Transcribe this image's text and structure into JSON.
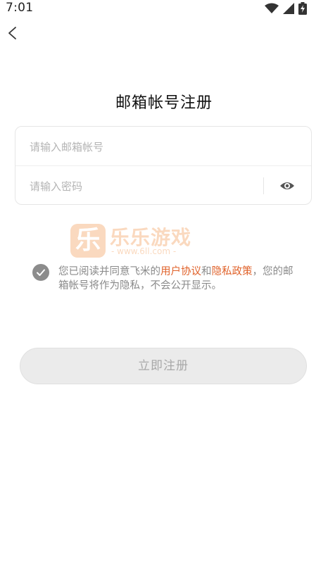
{
  "status_bar": {
    "time": "7:01",
    "icons": [
      "wifi-icon",
      "signal-icon",
      "battery-charging-icon"
    ]
  },
  "header": {
    "back_icon": "chevron-left-icon"
  },
  "title": "邮箱帐号注册",
  "form": {
    "email": {
      "value": "",
      "placeholder": "请输入邮箱帐号"
    },
    "password": {
      "value": "",
      "placeholder": "请输入密码",
      "toggle_icon": "eye-icon"
    }
  },
  "watermark": {
    "logo_char": "乐",
    "name": "乐乐游戏",
    "url": "- www.6ll.com -"
  },
  "agreement": {
    "checked": true,
    "prefix": "您已阅读并同意飞米的",
    "terms_link": "用户协议",
    "and": "和",
    "privacy_link": "隐私政策",
    "suffix": "，您的邮箱帐号将作为隐私，不会公开显示。"
  },
  "register_button": {
    "label": "立即注册",
    "enabled": false
  },
  "colors": {
    "link": "#e0622a",
    "button_disabled_bg": "#ebebeb",
    "button_disabled_text": "#a8a8a8",
    "check_bg": "#8c8c8c"
  }
}
